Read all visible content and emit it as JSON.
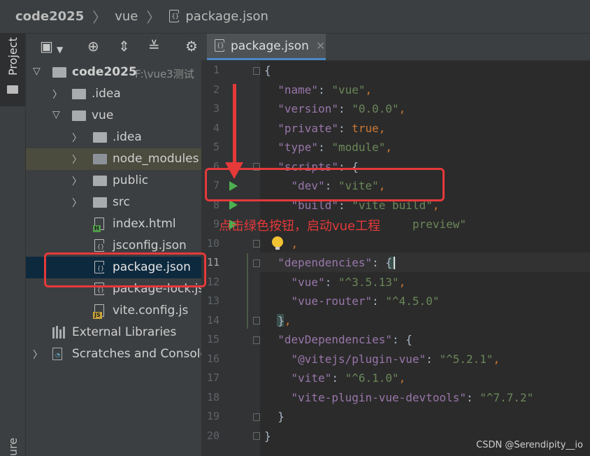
{
  "breadcrumb": {
    "root": "code2025",
    "folder": "vue",
    "file": "package.json"
  },
  "side_tabs": {
    "project": "Project",
    "bottom": "ure"
  },
  "project": {
    "items": [
      {
        "label": "code2025",
        "path": "F:\\vue3测试"
      },
      {
        "label": ".idea"
      },
      {
        "label": "vue"
      },
      {
        "label": ".idea"
      },
      {
        "label": "node_modules"
      },
      {
        "label": "public"
      },
      {
        "label": "src"
      },
      {
        "label": "index.html"
      },
      {
        "label": "jsconfig.json"
      },
      {
        "label": "package.json"
      },
      {
        "label": "package-lock.json"
      },
      {
        "label": "vite.config.js"
      },
      {
        "label": "External Libraries"
      },
      {
        "label": "Scratches and Consoles"
      }
    ]
  },
  "editor": {
    "tab": "package.json",
    "line_numbers": [
      "1",
      "2",
      "3",
      "4",
      "5",
      "6",
      "7",
      "8",
      "9",
      "10",
      "11",
      "12",
      "13",
      "14",
      "15",
      "16",
      "17",
      "18",
      "19",
      "20"
    ],
    "code": {
      "l1": "{",
      "l2_key": "\"name\"",
      "l2_val": "\"vue\"",
      "l3_key": "\"version\"",
      "l3_val": "\"0.0.0\"",
      "l4_key": "\"private\"",
      "l4_val": "true",
      "l5_key": "\"type\"",
      "l5_val": "\"module\"",
      "l6_key": "\"scripts\"",
      "l7_key": "\"dev\"",
      "l7_val": "\"vite\"",
      "l8_key": "\"build\"",
      "l8_val": "\"vite build\"",
      "l9_tail": "preview\"",
      "l11_key": "\"dependencies\"",
      "l12_key": "\"vue\"",
      "l12_val": "\"^3.5.13\"",
      "l13_key": "\"vue-router\"",
      "l13_val": "\"^4.5.0\"",
      "l15_key": "\"devDependencies\"",
      "l16_key": "\"@vitejs/plugin-vue\"",
      "l16_val": "\"^5.2.1\"",
      "l17_key": "\"vite\"",
      "l17_val": "\"^6.1.0\"",
      "l18_key": "\"vite-plugin-vue-devtools\"",
      "l18_val": "\"^7.7.2\""
    }
  },
  "annotation": {
    "text": "点击绿色按钮，启动vue工程",
    "color": "#e5393a"
  },
  "watermark": "CSDN @Serendipity__io",
  "icons": [
    "folder-icon",
    "json-file-icon",
    "html-file-icon",
    "js-file-icon",
    "run-icon",
    "lightbulb-icon",
    "libraries-icon",
    "scratches-icon"
  ]
}
